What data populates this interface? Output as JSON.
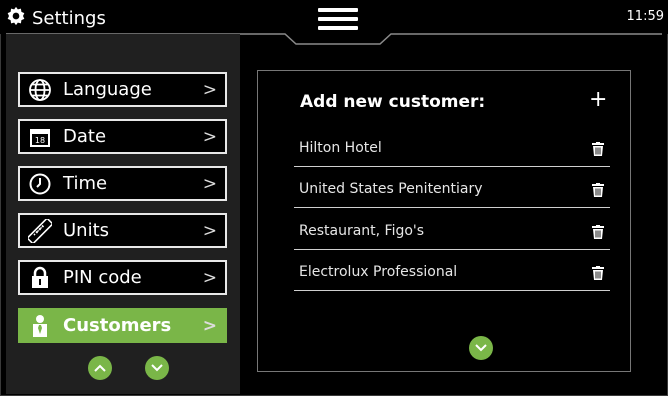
{
  "header": {
    "title": "Settings",
    "clock": "11:59"
  },
  "sidebar": {
    "items": [
      {
        "label": "Language",
        "icon": "globe-icon"
      },
      {
        "label": "Date",
        "icon": "calendar-icon",
        "icon_text": "18"
      },
      {
        "label": "Time",
        "icon": "clock-icon"
      },
      {
        "label": "Units",
        "icon": "ruler-icon"
      },
      {
        "label": "PIN code",
        "icon": "lock-icon"
      },
      {
        "label": "Customers",
        "icon": "person-icon",
        "active": true
      }
    ],
    "scroll_up": "chevron-up-icon",
    "scroll_down": "chevron-down-icon"
  },
  "panel": {
    "title": "Add new customer:",
    "add_label": "+",
    "customers": [
      {
        "name": "Hilton Hotel"
      },
      {
        "name": "United States Penitentiary"
      },
      {
        "name": "Restaurant, Figo's"
      },
      {
        "name": "Electrolux Professional"
      }
    ]
  },
  "colors": {
    "accent": "#7ab648",
    "background": "#000000",
    "sidebar": "#202020"
  }
}
